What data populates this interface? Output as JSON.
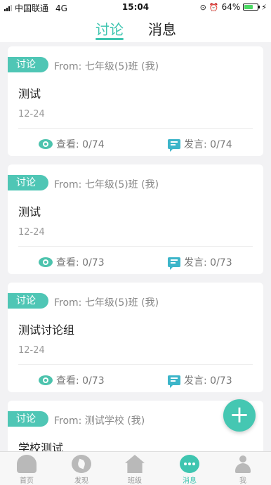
{
  "status": {
    "carrier": "中国联通",
    "network": "4G",
    "time": "15:04",
    "battery": "64%"
  },
  "header": {
    "tabs": [
      {
        "label": "讨论"
      },
      {
        "label": "消息"
      }
    ]
  },
  "cards": [
    {
      "tag": "讨论",
      "from": "From: 七年级(5)班 (我)",
      "title": "测试",
      "date": "12-24",
      "views": "查看: 0/74",
      "replies": "发言: 0/74"
    },
    {
      "tag": "讨论",
      "from": "From: 七年级(5)班 (我)",
      "title": "测试",
      "date": "12-24",
      "views": "查看: 0/73",
      "replies": "发言: 0/73"
    },
    {
      "tag": "讨论",
      "from": "From: 七年级(5)班 (我)",
      "title": "测试讨论组",
      "date": "12-24",
      "views": "查看: 0/73",
      "replies": "发言: 0/73"
    },
    {
      "tag": "讨论",
      "from": "From: 测试学校 (我)",
      "title": "学校测试"
    }
  ],
  "fab": {
    "label": "+"
  },
  "bottom_nav": [
    {
      "label": "首页",
      "icon": "home-icon"
    },
    {
      "label": "发现",
      "icon": "discover-icon"
    },
    {
      "label": "班级",
      "icon": "class-icon"
    },
    {
      "label": "消息",
      "icon": "message-icon"
    },
    {
      "label": "我",
      "icon": "profile-icon"
    }
  ],
  "colors": {
    "accent": "#3fc5b0",
    "tag": "#4fc6b5",
    "bubble": "#3cb5c9"
  }
}
